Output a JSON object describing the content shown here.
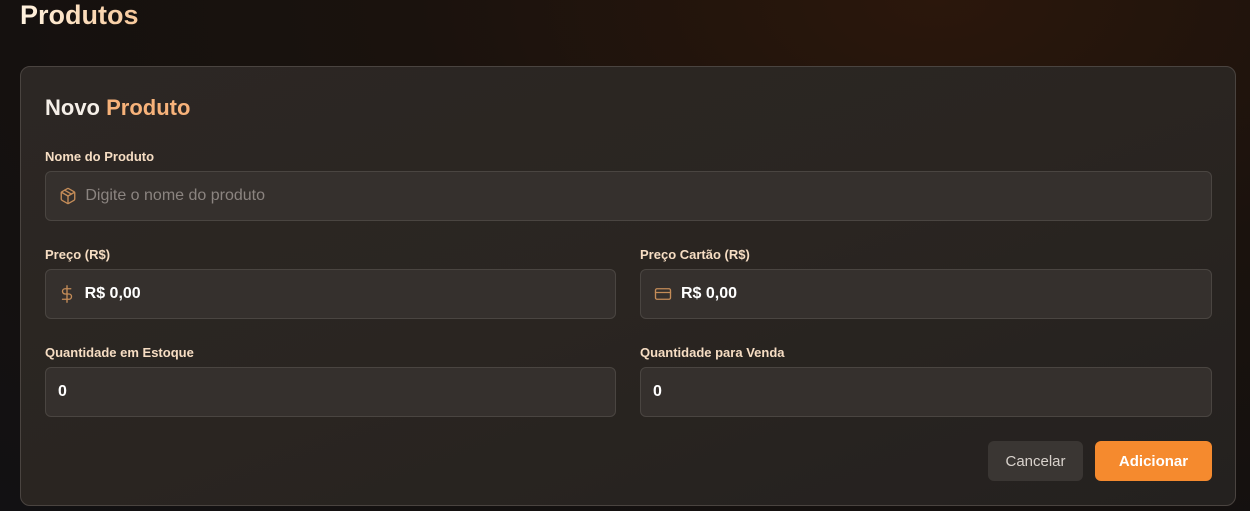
{
  "page": {
    "title": "Produtos"
  },
  "form": {
    "title_part1": "Novo",
    "title_part2": "Produto",
    "name": {
      "label": "Nome do Produto",
      "placeholder": "Digite o nome do produto",
      "value": "",
      "icon": "package-icon"
    },
    "price": {
      "label": "Preço (R$)",
      "value": "R$ 0,00",
      "icon": "dollar-icon"
    },
    "card_price": {
      "label": "Preço Cartão (R$)",
      "value": "R$ 0,00",
      "icon": "credit-card-icon"
    },
    "stock_qty": {
      "label": "Quantidade em Estoque",
      "value": "0"
    },
    "sale_qty": {
      "label": "Quantidade para Venda",
      "value": "0"
    },
    "cancel_label": "Cancelar",
    "add_label": "Adicionar"
  },
  "colors": {
    "accent": "#f58a2e",
    "label": "#f6ddc3",
    "icon": "#c48c58"
  }
}
